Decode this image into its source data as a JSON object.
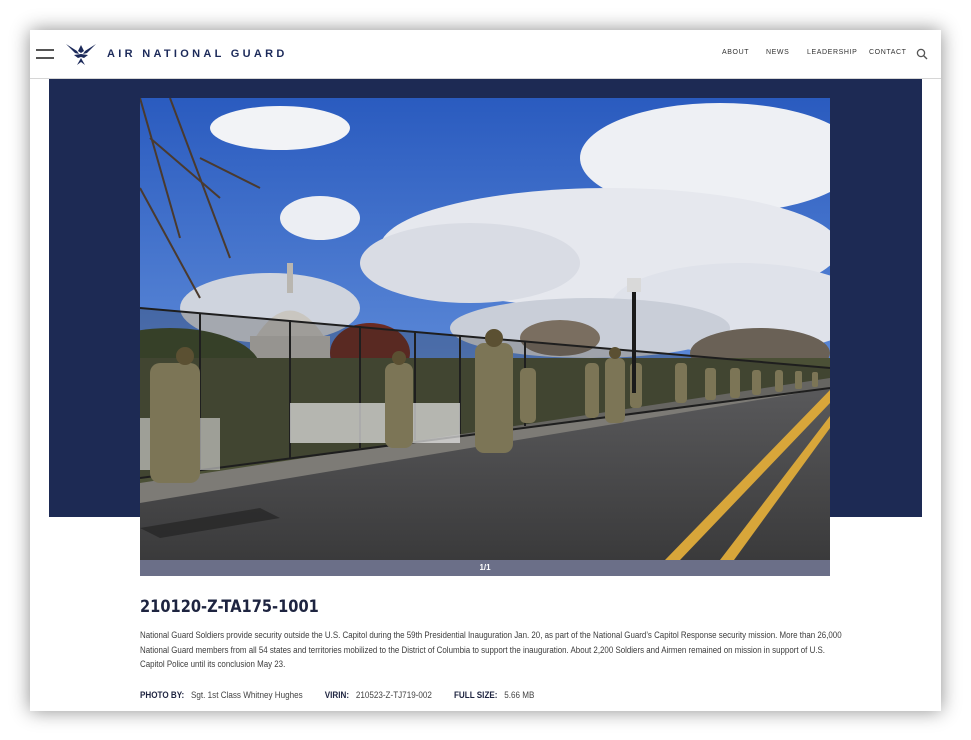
{
  "header": {
    "site_title": "AIR NATIONAL GUARD",
    "nav": [
      "ABOUT",
      "NEWS",
      "LEADERSHIP",
      "CONTACT"
    ]
  },
  "gallery": {
    "counter": "1/1"
  },
  "image": {
    "id": "210120-Z-TA175-1001",
    "caption": "National Guard Soldiers provide security outside the U.S. Capitol during the 59th Presidential Inauguration Jan. 20, as part of the National Guard’s Capitol Response security mission. More than 26,000 National Guard members from all 54 states and territories mobilized to the District of Columbia to support the inauguration. About 2,200 Soldiers and Airmen remained on mission in support of U.S. Capitol Police until its conclusion May 23.",
    "photo_by_label": "PHOTO BY:",
    "photo_by": "Sgt. 1st Class Whitney Hughes",
    "virin_label": "VIRIN:",
    "virin": "210523-Z-TJ719-002",
    "full_size_label": "FULL SIZE:",
    "full_size": "5.66 MB"
  },
  "colors": {
    "hero_band": "#1d2a54",
    "title_text": "#1c2a5a",
    "counter_bar": "#6b6f88"
  },
  "icons": [
    "menu-icon",
    "air-force-wings-logo",
    "search-icon"
  ]
}
